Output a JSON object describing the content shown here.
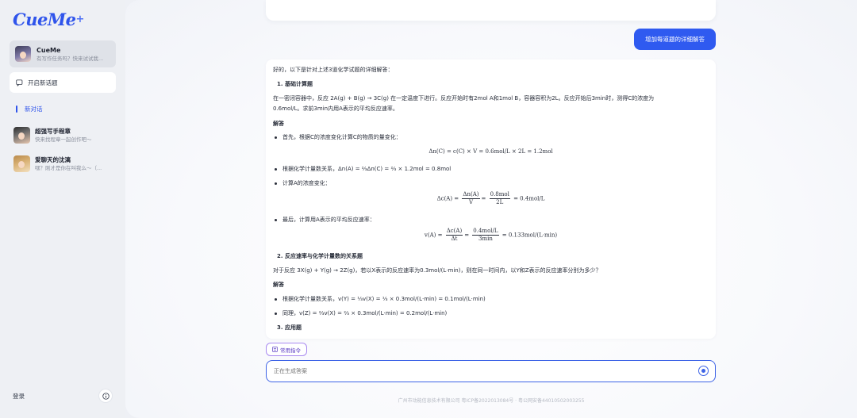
{
  "app": {
    "logo": "CueMe",
    "logo_plus": "+"
  },
  "sidebar": {
    "assistant": {
      "name": "CueMe",
      "subtitle": "有写作任务吗？快来试试我..."
    },
    "new_topic": "开启新话题",
    "current_chat": "新对话",
    "characters": [
      {
        "name": "超强写手程章",
        "subtitle": "快来找程章一起创作吧～"
      },
      {
        "name": "爱聊天的沈漓",
        "subtitle": "嘿？刚才是你在叫我么～（..."
      }
    ],
    "login": "登录",
    "info_icon": "info-icon"
  },
  "chat": {
    "user_message": "增加每道题的详细解答",
    "answer": {
      "intro": "好的，以下是针对上述3道化学试题的详细解答：",
      "q1_title": "1. 基础计算题",
      "q1_text_a": "在一密闭容器中，反应 2A(g) + B(g) → 3C(g) 在一定温度下进行。反应开始时有2mol A和1mol B，容器容积为2L。反应开始后3min时，测得C的浓度为",
      "q1_text_b": "0.6mol/L。求前3min内用A表示的平均反应速率。",
      "answer_label": "解答",
      "q1_b1": "首先，根据C的浓度变化计算C的物质的量变化：",
      "q1_eq1": "Δn(C) = c(C) × V = 0.6mol/L × 2L = 1.2mol",
      "q1_b2": "根据化学计量数关系，Δn(A) = ⅔Δn(C) = ⅔ × 1.2mol = 0.8mol",
      "q1_b3": "计算A的浓度变化：",
      "q1_eq2_left": "Δc(A) =",
      "q1_eq2_f1_num": "Δn(A)",
      "q1_eq2_f1_den": "V",
      "q1_eq2_f2_num": "0.8mol",
      "q1_eq2_f2_den": "2L",
      "q1_eq2_right": "= 0.4mol/L",
      "q1_b4": "最后，计算用A表示的平均反应速率：",
      "q1_eq3_left": "v(A) =",
      "q1_eq3_f1_num": "Δc(A)",
      "q1_eq3_f1_den": "Δt",
      "q1_eq3_f2_num": "0.4mol/L",
      "q1_eq3_f2_den": "3min",
      "q1_eq3_right": "= 0.133mol/(L·min)",
      "q2_title": "2. 反应速率与化学计量数的关系题",
      "q2_text": "对于反应 3X(g) + Y(g) → 2Z(g)，若以X表示的反应速率为0.3mol/(L·min)，则在同一时间内，以Y和Z表示的反应速率分别为多少？",
      "q2_b1": "根据化学计量数关系，v(Y) = ⅓v(X) = ⅓ × 0.3mol/(L·min) = 0.1mol/(L·min)",
      "q2_b2": "同理，v(Z) = ⅔v(X) = ⅔ × 0.3mol/(L·min) = 0.2mol/(L·min)",
      "q3_title": "3. 应用题"
    },
    "common_commands": "常用指令",
    "input_placeholder": "正在生成答案",
    "footer": "广州市动能信息技术有限公司 粤ICP备2022013084号 · 粤公网安备44010502003255"
  },
  "colors": {
    "accent": "#2f5af0",
    "command_border": "#a889f0"
  }
}
